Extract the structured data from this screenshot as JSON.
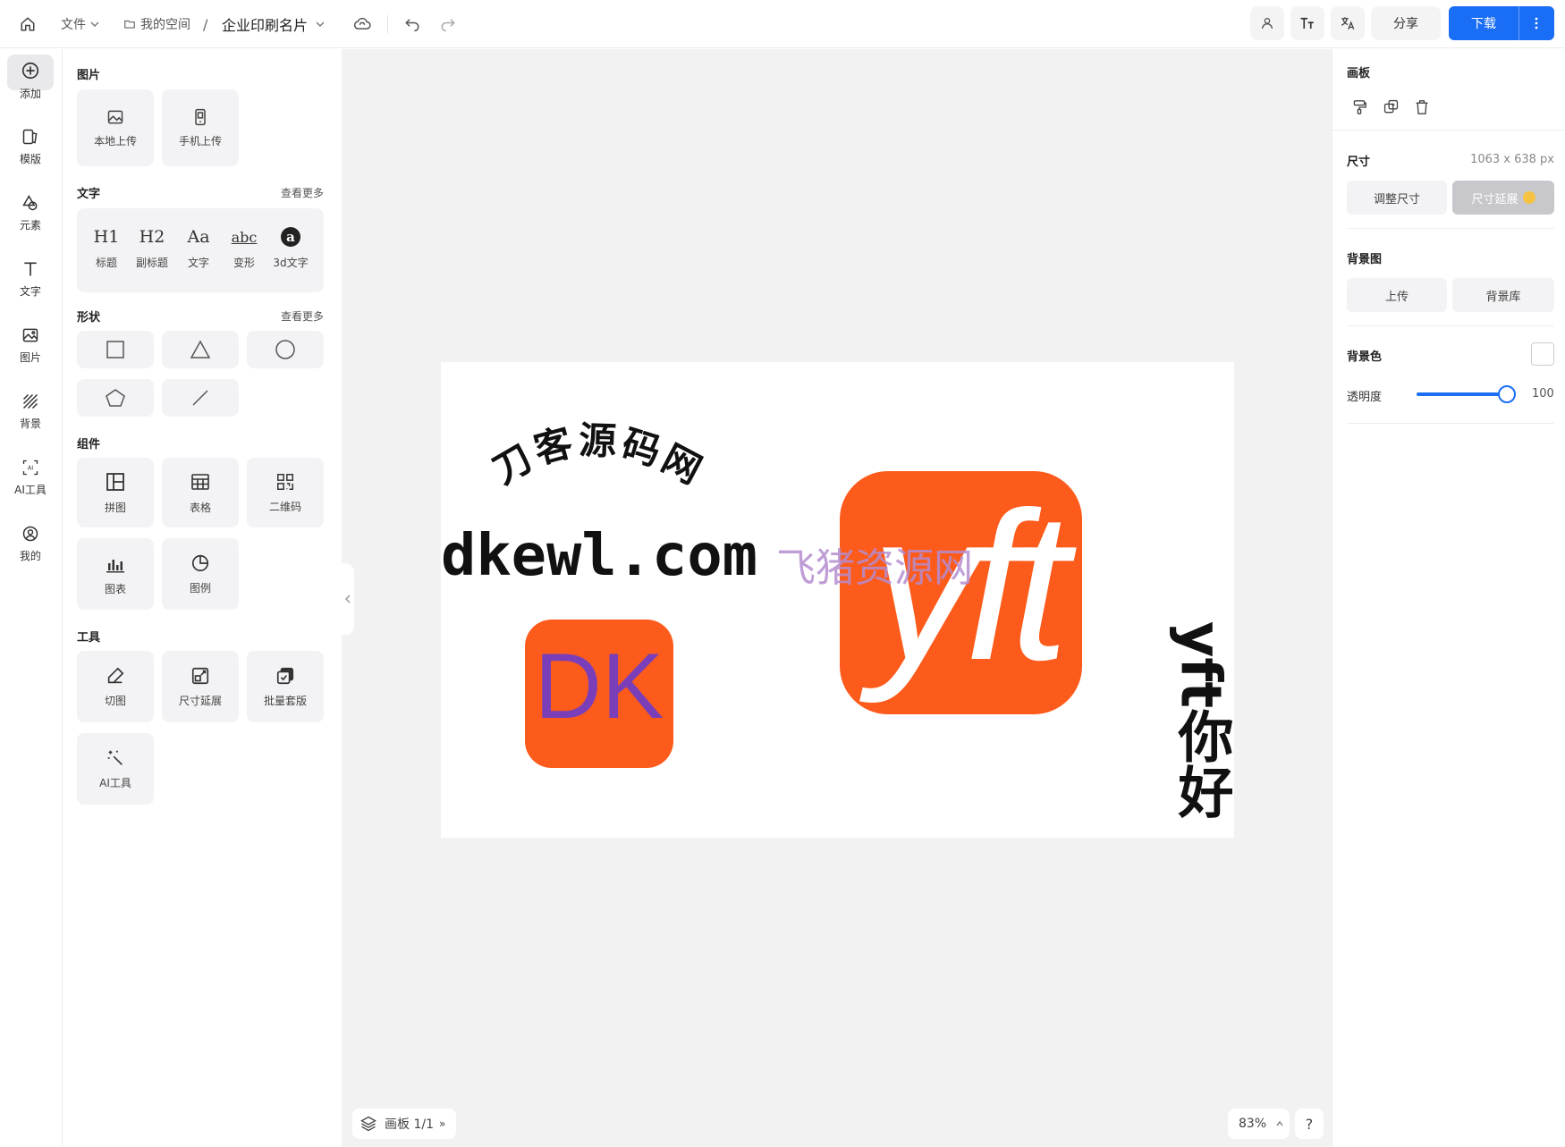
{
  "topbar": {
    "file_menu": "文件",
    "breadcrumb_space": "我的空间",
    "breadcrumb_sep": "/",
    "doc_title": "企业印刷名片",
    "share_label": "分享",
    "download_label": "下载"
  },
  "rail": {
    "items": [
      {
        "label": "添加",
        "icon": "add-circle-icon"
      },
      {
        "label": "模版",
        "icon": "template-icon"
      },
      {
        "label": "元素",
        "icon": "element-icon"
      },
      {
        "label": "文字",
        "icon": "text-icon"
      },
      {
        "label": "图片",
        "icon": "image-icon"
      },
      {
        "label": "背景",
        "icon": "background-icon"
      },
      {
        "label": "AI工具",
        "icon": "ai-tool-icon"
      },
      {
        "label": "我的",
        "icon": "user-icon"
      }
    ]
  },
  "panel": {
    "images_title": "图片",
    "local_upload": "本地上传",
    "phone_upload": "手机上传",
    "text_title": "文字",
    "see_more": "查看更多",
    "text_items": [
      {
        "glyph": "H1",
        "label": "标题"
      },
      {
        "glyph": "H2",
        "label": "副标题"
      },
      {
        "glyph": "Aa",
        "label": "文字"
      },
      {
        "glyph": "abc",
        "label": "变形"
      },
      {
        "glyph": "a",
        "label": "3d文字"
      }
    ],
    "shapes_title": "形状",
    "components_title": "组件",
    "components": [
      "拼图",
      "表格",
      "二维码",
      "图表",
      "图例"
    ],
    "tools_title": "工具",
    "tools": [
      "切图",
      "尺寸延展",
      "批量套版",
      "AI工具"
    ]
  },
  "canvas": {
    "arc_text": "刀客源码网",
    "url_text": "dkewl.com",
    "watermark": "飞猪资源网",
    "dk_logo": "DK",
    "yft_logo": "yft",
    "vertical_text": "yft你好",
    "colors": {
      "orange": "#fd5b1b",
      "purple": "#7a3fb8"
    }
  },
  "bottom": {
    "board_label": "画板 1/1",
    "zoom": "83%",
    "help": "?"
  },
  "props": {
    "board_title": "画板",
    "size_title": "尺寸",
    "size_value": "1063 x 638 px",
    "resize_label": "调整尺寸",
    "extend_label": "尺寸延展",
    "bg_image_title": "背景图",
    "upload_label": "上传",
    "bg_library_label": "背景库",
    "bg_color_title": "背景色",
    "opacity_label": "透明度",
    "opacity_value": "100"
  },
  "colors": {
    "accent": "#1a6ef5"
  }
}
